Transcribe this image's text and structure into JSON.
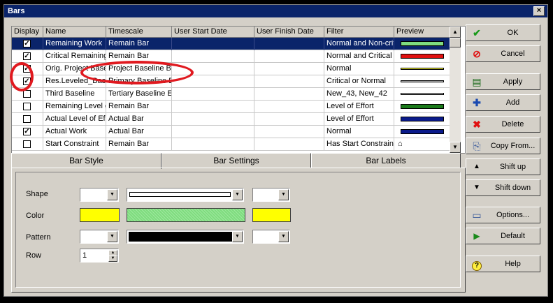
{
  "window": {
    "title": "Bars",
    "close": "×"
  },
  "columns": [
    "Display",
    "Name",
    "Timescale",
    "User Start Date",
    "User Finish Date",
    "Filter",
    "Preview"
  ],
  "rows": [
    {
      "checked": true,
      "name": "Remaining Work",
      "timescale": "Remain Bar",
      "filter": "Normal and Non-crit",
      "preview_color": "#7fdc7f",
      "selected": true
    },
    {
      "checked": true,
      "name": "Critical Remaining",
      "timescale": "Remain Bar",
      "filter": "Normal and Critical",
      "preview_color": "#e01010"
    },
    {
      "checked": true,
      "name": "Orig. Project Base",
      "timescale": "Project Baseline B",
      "filter": "Normal",
      "preview_color": "#ffff30"
    },
    {
      "checked": true,
      "name": "Res.Leveled_Bas",
      "timescale": "Primary Baseline B",
      "filter": "Critical or Normal",
      "preview_color": "#c0c0c0"
    },
    {
      "checked": false,
      "name": "Third Baseline",
      "timescale": "Tertiary Baseline E",
      "filter": "New_43, New_42",
      "preview_color": "#ffffff"
    },
    {
      "checked": false,
      "name": "Remaining Level o",
      "timescale": "Remain Bar",
      "filter": "Level of Effort",
      "preview_color": "#1a7a1a"
    },
    {
      "checked": false,
      "name": "Actual Level of Ef",
      "timescale": "Actual Bar",
      "filter": "Level of Effort",
      "preview_color": "#0a1a8a"
    },
    {
      "checked": true,
      "name": "Actual Work",
      "timescale": "Actual Bar",
      "filter": "Normal",
      "preview_color": "#0a1a8a"
    },
    {
      "checked": false,
      "name": "Start Constraint",
      "timescale": "Remain Bar",
      "filter": "Has Start Constrain",
      "preview_color": "",
      "preview_icon": "⌂"
    }
  ],
  "buttons": {
    "ok": "OK",
    "cancel": "Cancel",
    "apply": "Apply",
    "add": "Add",
    "delete": "Delete",
    "copy_from": "Copy From...",
    "shift_up": "Shift up",
    "shift_down": "Shift down",
    "options": "Options...",
    "default": "Default",
    "help": "Help"
  },
  "tabs": [
    "Bar Style",
    "Bar Settings",
    "Bar Labels"
  ],
  "bar_style": {
    "shape_label": "Shape",
    "color_label": "Color",
    "pattern_label": "Pattern",
    "row_label": "Row",
    "row_value": "1",
    "start_color": "#ffff00",
    "middle_color": "#7fdc7f",
    "end_color": "#ffff00"
  },
  "colors": {
    "title_bar": "#0a246a",
    "annotation": "#e0191f",
    "dialog": "#d4d0c8"
  }
}
